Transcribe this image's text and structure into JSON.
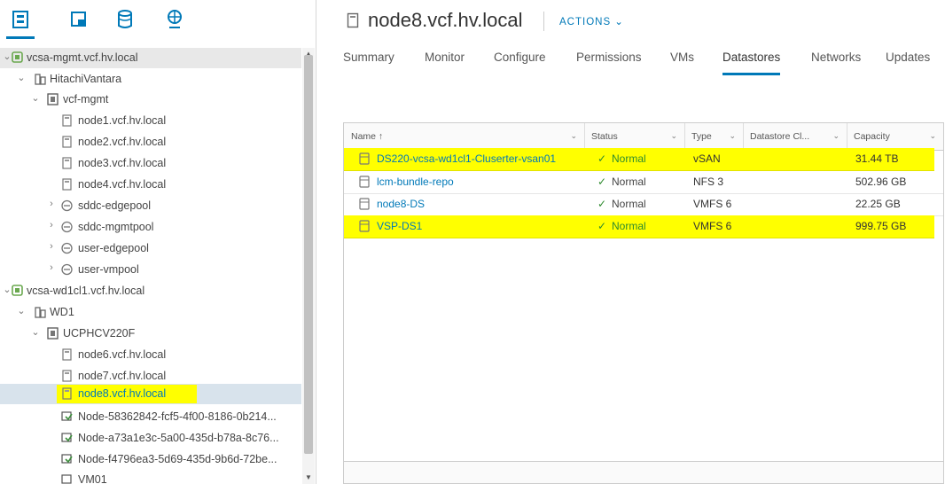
{
  "title": "node8.vcf.hv.local",
  "actions_label": "ACTIONS ⌄",
  "nav_icons": [
    "hosts-clusters-icon",
    "vms-templates-icon",
    "storage-icon",
    "networking-icon"
  ],
  "tree": [
    {
      "label": "vcsa-mgmt.vcf.hv.local",
      "icon": "vcenter-icon"
    },
    {
      "label": "HitachiVantara",
      "icon": "datacenter-icon"
    },
    {
      "label": "vcf-mgmt",
      "icon": "cluster-icon"
    },
    {
      "label": "node1.vcf.hv.local",
      "icon": "host-icon"
    },
    {
      "label": "node2.vcf.hv.local",
      "icon": "host-icon"
    },
    {
      "label": "node3.vcf.hv.local",
      "icon": "host-icon"
    },
    {
      "label": "node4.vcf.hv.local",
      "icon": "host-icon"
    },
    {
      "label": "sddc-edgepool",
      "icon": "resource-pool-icon"
    },
    {
      "label": "sddc-mgmtpool",
      "icon": "resource-pool-icon"
    },
    {
      "label": "user-edgepool",
      "icon": "resource-pool-icon"
    },
    {
      "label": "user-vmpool",
      "icon": "resource-pool-icon"
    },
    {
      "label": "vcsa-wd1cl1.vcf.hv.local",
      "icon": "vcenter-icon"
    },
    {
      "label": "WD1",
      "icon": "datacenter-icon"
    },
    {
      "label": "UCPHCV220F",
      "icon": "cluster-icon"
    },
    {
      "label": "node6.vcf.hv.local",
      "icon": "host-icon"
    },
    {
      "label": "node7.vcf.hv.local",
      "icon": "host-icon"
    },
    {
      "label": "node8.vcf.hv.local",
      "icon": "host-icon"
    },
    {
      "label": "Node-58362842-fcf5-4f00-8186-0b214...",
      "icon": "vm-icon"
    },
    {
      "label": "Node-a73a1e3c-5a00-435d-b78a-8c76...",
      "icon": "vm-icon"
    },
    {
      "label": "Node-f4796ea3-5d69-435d-9b6d-72be...",
      "icon": "vm-icon"
    },
    {
      "label": "VM01",
      "icon": "vm-icon"
    }
  ],
  "tabs": [
    "Summary",
    "Monitor",
    "Configure",
    "Permissions",
    "VMs",
    "Datastores",
    "Networks",
    "Updates"
  ],
  "active_tab": "Datastores",
  "columns": [
    {
      "label": "Name ↑"
    },
    {
      "label": "Status"
    },
    {
      "label": "Type"
    },
    {
      "label": "Datastore Cl..."
    },
    {
      "label": "Capacity"
    }
  ],
  "rows": [
    {
      "name": "DS220-vcsa-wd1cl1-Cluserter-vsan01",
      "status": "Normal",
      "type": "vSAN",
      "cluster": "",
      "capacity": "31.44 TB",
      "highlight": true
    },
    {
      "name": "lcm-bundle-repo",
      "status": "Normal",
      "type": "NFS 3",
      "cluster": "",
      "capacity": "502.96 GB",
      "highlight": false
    },
    {
      "name": "node8-DS",
      "status": "Normal",
      "type": "VMFS 6",
      "cluster": "",
      "capacity": "22.25 GB",
      "highlight": false
    },
    {
      "name": "VSP-DS1",
      "status": "Normal",
      "type": "VMFS 6",
      "cluster": "",
      "capacity": "999.75 GB",
      "highlight": true
    }
  ],
  "colors": {
    "accent": "#0079b8",
    "highlight": "#ffff00",
    "ok": "#2e8b2e"
  }
}
